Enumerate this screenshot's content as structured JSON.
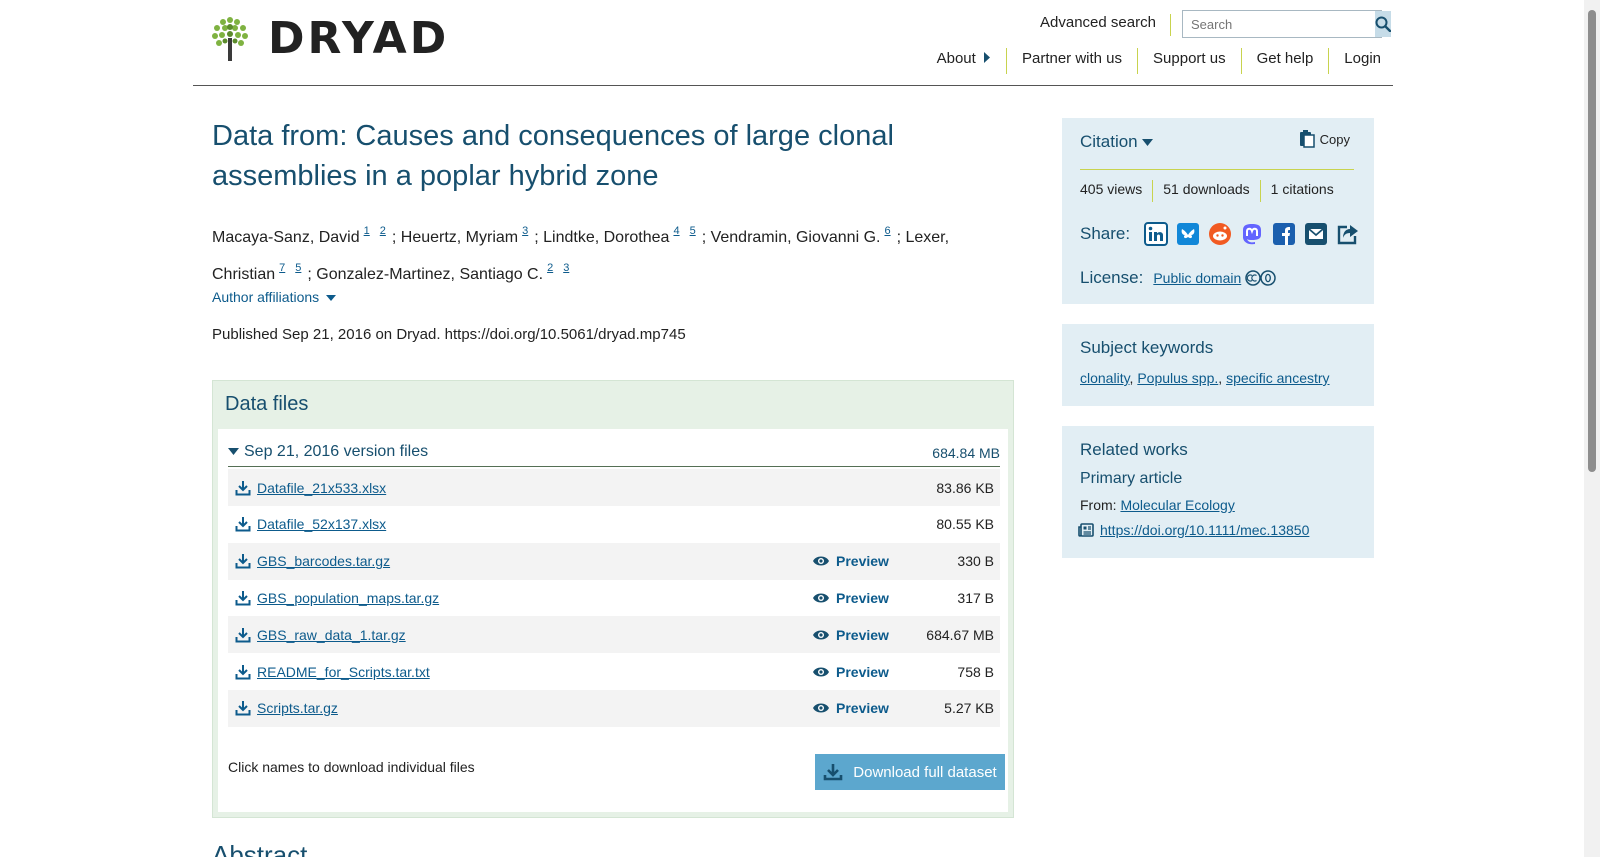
{
  "header": {
    "logo_text": "DRYAD",
    "advanced_search": "Advanced search",
    "search_placeholder": "Search",
    "nav": [
      "About",
      "Partner with us",
      "Support us",
      "Get help",
      "Login"
    ]
  },
  "dataset": {
    "title": "Data from: Causes and consequences of large clonal assemblies in a poplar hybrid zone",
    "authors": [
      {
        "name": "Macaya-Sanz, David",
        "affil": [
          "1",
          "2"
        ]
      },
      {
        "name": "Heuertz, Myriam",
        "affil": [
          "3"
        ]
      },
      {
        "name": "Lindtke, Dorothea",
        "affil": [
          "4",
          "5"
        ]
      },
      {
        "name": "Vendramin, Giovanni G.",
        "affil": [
          "6"
        ]
      },
      {
        "name": "Lexer, Christian",
        "affil": [
          "7",
          "5"
        ]
      },
      {
        "name": "Gonzalez-Martinez, Santiago C.",
        "affil": [
          "2",
          "3"
        ]
      }
    ],
    "author_affiliations": "Author affiliations",
    "published": "Published Sep 21, 2016 on Dryad. https://doi.org/10.5061/dryad.mp745"
  },
  "files": {
    "title": "Data files",
    "version_label": "Sep 21, 2016 version files",
    "version_total": "684.84 MB",
    "preview_label": "Preview",
    "items": [
      {
        "name": "Datafile_21x533.xlsx",
        "size": "83.86 KB",
        "preview": false
      },
      {
        "name": "Datafile_52x137.xlsx",
        "size": "80.55 KB",
        "preview": false
      },
      {
        "name": "GBS_barcodes.tar.gz",
        "size": "330 B",
        "preview": true
      },
      {
        "name": "GBS_population_maps.tar.gz",
        "size": "317 B",
        "preview": true
      },
      {
        "name": "GBS_raw_data_1.tar.gz",
        "size": "684.67 MB",
        "preview": true
      },
      {
        "name": "README_for_Scripts.tar.txt",
        "size": "758 B",
        "preview": true
      },
      {
        "name": "Scripts.tar.gz",
        "size": "5.27 KB",
        "preview": true
      }
    ],
    "note": "Click names to download individual files",
    "download_full": "Download full dataset"
  },
  "abstract_heading": "Abstract",
  "sidebar": {
    "citation": {
      "label": "Citation",
      "copy": "Copy",
      "views": "405 views",
      "downloads": "51 downloads",
      "citations": "1 citations",
      "share_label": "Share:",
      "share_icons": [
        "linkedin-icon",
        "bluesky-icon",
        "reddit-icon",
        "mastodon-icon",
        "facebook-icon",
        "email-icon",
        "share-icon"
      ],
      "license_label": "License:",
      "license_value": "Public domain"
    },
    "keywords": {
      "title": "Subject keywords",
      "items": [
        "clonality",
        "Populus spp.",
        "specific ancestry"
      ]
    },
    "related": {
      "title": "Related works",
      "primary": "Primary article",
      "from_label": "From:",
      "from_journal": "Molecular Ecology",
      "doi": "https://doi.org/10.1111/mec.13850"
    }
  },
  "colors": {
    "accent": "#174f6e",
    "link": "#0d5b8c",
    "files_bg": "#e6f1e6",
    "sidebar_bg": "#e2eef4",
    "divider": "#c8d34e",
    "download_btn": "#5ca7ce"
  }
}
